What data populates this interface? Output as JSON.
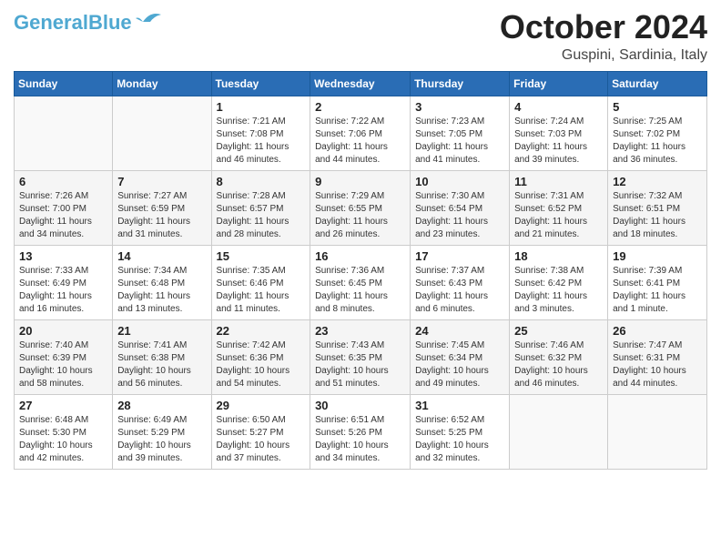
{
  "header": {
    "logo": {
      "line1": "General",
      "line2": "Blue"
    },
    "month": "October 2024",
    "location": "Guspini, Sardinia, Italy"
  },
  "days_of_week": [
    "Sunday",
    "Monday",
    "Tuesday",
    "Wednesday",
    "Thursday",
    "Friday",
    "Saturday"
  ],
  "weeks": [
    [
      {
        "day": "",
        "info": ""
      },
      {
        "day": "",
        "info": ""
      },
      {
        "day": "1",
        "info": "Sunrise: 7:21 AM\nSunset: 7:08 PM\nDaylight: 11 hours and 46 minutes."
      },
      {
        "day": "2",
        "info": "Sunrise: 7:22 AM\nSunset: 7:06 PM\nDaylight: 11 hours and 44 minutes."
      },
      {
        "day": "3",
        "info": "Sunrise: 7:23 AM\nSunset: 7:05 PM\nDaylight: 11 hours and 41 minutes."
      },
      {
        "day": "4",
        "info": "Sunrise: 7:24 AM\nSunset: 7:03 PM\nDaylight: 11 hours and 39 minutes."
      },
      {
        "day": "5",
        "info": "Sunrise: 7:25 AM\nSunset: 7:02 PM\nDaylight: 11 hours and 36 minutes."
      }
    ],
    [
      {
        "day": "6",
        "info": "Sunrise: 7:26 AM\nSunset: 7:00 PM\nDaylight: 11 hours and 34 minutes."
      },
      {
        "day": "7",
        "info": "Sunrise: 7:27 AM\nSunset: 6:59 PM\nDaylight: 11 hours and 31 minutes."
      },
      {
        "day": "8",
        "info": "Sunrise: 7:28 AM\nSunset: 6:57 PM\nDaylight: 11 hours and 28 minutes."
      },
      {
        "day": "9",
        "info": "Sunrise: 7:29 AM\nSunset: 6:55 PM\nDaylight: 11 hours and 26 minutes."
      },
      {
        "day": "10",
        "info": "Sunrise: 7:30 AM\nSunset: 6:54 PM\nDaylight: 11 hours and 23 minutes."
      },
      {
        "day": "11",
        "info": "Sunrise: 7:31 AM\nSunset: 6:52 PM\nDaylight: 11 hours and 21 minutes."
      },
      {
        "day": "12",
        "info": "Sunrise: 7:32 AM\nSunset: 6:51 PM\nDaylight: 11 hours and 18 minutes."
      }
    ],
    [
      {
        "day": "13",
        "info": "Sunrise: 7:33 AM\nSunset: 6:49 PM\nDaylight: 11 hours and 16 minutes."
      },
      {
        "day": "14",
        "info": "Sunrise: 7:34 AM\nSunset: 6:48 PM\nDaylight: 11 hours and 13 minutes."
      },
      {
        "day": "15",
        "info": "Sunrise: 7:35 AM\nSunset: 6:46 PM\nDaylight: 11 hours and 11 minutes."
      },
      {
        "day": "16",
        "info": "Sunrise: 7:36 AM\nSunset: 6:45 PM\nDaylight: 11 hours and 8 minutes."
      },
      {
        "day": "17",
        "info": "Sunrise: 7:37 AM\nSunset: 6:43 PM\nDaylight: 11 hours and 6 minutes."
      },
      {
        "day": "18",
        "info": "Sunrise: 7:38 AM\nSunset: 6:42 PM\nDaylight: 11 hours and 3 minutes."
      },
      {
        "day": "19",
        "info": "Sunrise: 7:39 AM\nSunset: 6:41 PM\nDaylight: 11 hours and 1 minute."
      }
    ],
    [
      {
        "day": "20",
        "info": "Sunrise: 7:40 AM\nSunset: 6:39 PM\nDaylight: 10 hours and 58 minutes."
      },
      {
        "day": "21",
        "info": "Sunrise: 7:41 AM\nSunset: 6:38 PM\nDaylight: 10 hours and 56 minutes."
      },
      {
        "day": "22",
        "info": "Sunrise: 7:42 AM\nSunset: 6:36 PM\nDaylight: 10 hours and 54 minutes."
      },
      {
        "day": "23",
        "info": "Sunrise: 7:43 AM\nSunset: 6:35 PM\nDaylight: 10 hours and 51 minutes."
      },
      {
        "day": "24",
        "info": "Sunrise: 7:45 AM\nSunset: 6:34 PM\nDaylight: 10 hours and 49 minutes."
      },
      {
        "day": "25",
        "info": "Sunrise: 7:46 AM\nSunset: 6:32 PM\nDaylight: 10 hours and 46 minutes."
      },
      {
        "day": "26",
        "info": "Sunrise: 7:47 AM\nSunset: 6:31 PM\nDaylight: 10 hours and 44 minutes."
      }
    ],
    [
      {
        "day": "27",
        "info": "Sunrise: 6:48 AM\nSunset: 5:30 PM\nDaylight: 10 hours and 42 minutes."
      },
      {
        "day": "28",
        "info": "Sunrise: 6:49 AM\nSunset: 5:29 PM\nDaylight: 10 hours and 39 minutes."
      },
      {
        "day": "29",
        "info": "Sunrise: 6:50 AM\nSunset: 5:27 PM\nDaylight: 10 hours and 37 minutes."
      },
      {
        "day": "30",
        "info": "Sunrise: 6:51 AM\nSunset: 5:26 PM\nDaylight: 10 hours and 34 minutes."
      },
      {
        "day": "31",
        "info": "Sunrise: 6:52 AM\nSunset: 5:25 PM\nDaylight: 10 hours and 32 minutes."
      },
      {
        "day": "",
        "info": ""
      },
      {
        "day": "",
        "info": ""
      }
    ]
  ]
}
